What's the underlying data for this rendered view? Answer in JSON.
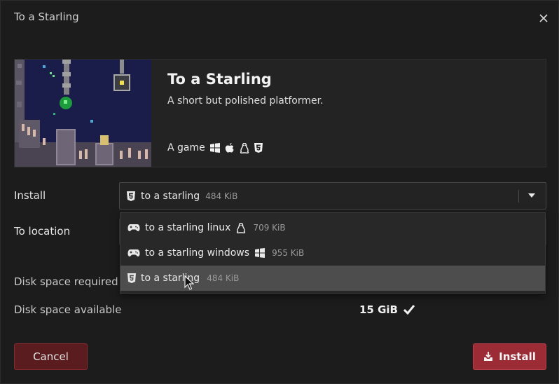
{
  "dialog": {
    "title": "To a Starling"
  },
  "game": {
    "title": "To a Starling",
    "description": "A short but polished platformer.",
    "kind": "A game",
    "platform_icons": [
      "windows-icon",
      "apple-icon",
      "linux-icon",
      "html5-icon"
    ]
  },
  "install": {
    "label": "Install",
    "selected": {
      "icon": "html5-icon",
      "name": "to a starling",
      "size": "484 KiB"
    },
    "options": [
      {
        "icon": "gamepad-icon",
        "name": "to a starling linux",
        "platform_icon": "linux-icon",
        "size": "709 KiB"
      },
      {
        "icon": "gamepad-icon",
        "name": "to a starling windows",
        "platform_icon": "windows-icon",
        "size": "955 KiB"
      },
      {
        "icon": "html5-icon",
        "name": "to a starling",
        "size": "484 KiB",
        "highlighted": true
      }
    ]
  },
  "location": {
    "label": "To location"
  },
  "disk": {
    "required_label": "Disk space required",
    "available_label": "Disk space available",
    "available_value": "15 GiB"
  },
  "buttons": {
    "cancel": "Cancel",
    "install": "Install"
  },
  "colors": {
    "background": "#1c1c1c",
    "accent": "#9b2b34",
    "cancel_bg": "#5a1c1f",
    "highlight": "#4d4d4d"
  }
}
